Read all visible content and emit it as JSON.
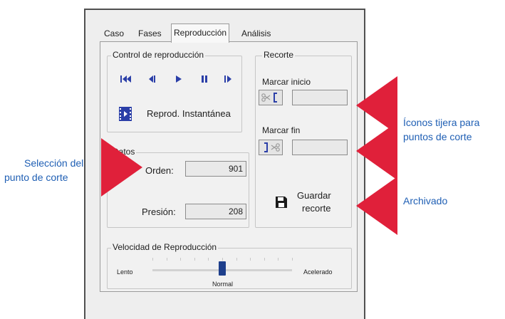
{
  "tabs": [
    "Caso",
    "Fases",
    "Reproducción",
    "Análisis"
  ],
  "playback": {
    "group_title": "Control de reproducción",
    "buttons": [
      "skip-to-start",
      "step-back",
      "play",
      "pause",
      "step-forward"
    ],
    "instant_label": "Reprod. Instantánea"
  },
  "data": {
    "group_title": "Datos",
    "orden_label": "Orden:",
    "orden_value": "901",
    "presion_label": "Presión:",
    "presion_value": "208"
  },
  "trim": {
    "group_title": "Recorte",
    "mark_start_label": "Marcar inicio",
    "mark_start_value": "",
    "mark_end_label": "Marcar fin",
    "mark_end_value": "",
    "save_label_line1": "Guardar",
    "save_label_line2": "recorte"
  },
  "speed": {
    "group_title": "Velocidad de Reproducción",
    "slow_label": "Lento",
    "fast_label": "Acelerado",
    "normal_label": "Normal",
    "level": 0.5
  },
  "annotations": {
    "scissors_line1": "Íconos tijera para",
    "scissors_line2": "puntos de corte",
    "cut_point_line1": "Selección del",
    "cut_point_line2": "punto de corte",
    "archive": "Archivado"
  },
  "colors": {
    "icon_blue": "#2b3fa8",
    "arrow_red": "#e0203a",
    "annotation_blue": "#1f5fb4",
    "thumb": "#1e3f8c"
  },
  "icons": [
    "skip-start-icon",
    "step-back-icon",
    "play-icon",
    "pause-icon",
    "step-forward-icon",
    "film-icon",
    "scissors-start-icon",
    "scissors-end-icon",
    "floppy-disk-icon"
  ]
}
